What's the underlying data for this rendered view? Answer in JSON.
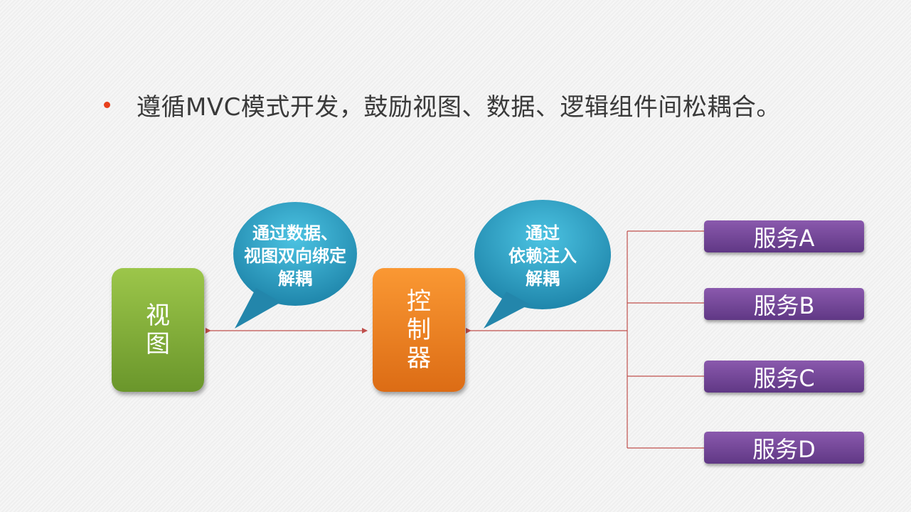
{
  "header": {
    "bullet_text": "遵循MVC模式开发，鼓励视图、数据、逻辑组件间松耦合。"
  },
  "diagram": {
    "view_label": "视图",
    "controller_label": "控制器",
    "bubble_left": [
      "通过数据、",
      "视图双向绑定",
      "解耦"
    ],
    "bubble_right": [
      "通过",
      "依赖注入",
      "解耦"
    ],
    "services": [
      "服务A",
      "服务B",
      "服务C",
      "服务D"
    ]
  },
  "colors": {
    "bullet": "#e8401c",
    "view_green": "#7fae37",
    "controller_orange": "#f0841f",
    "bubble_blue": "#2c98bf",
    "service_purple": "#6f4594",
    "connector_red": "#c0504d"
  }
}
